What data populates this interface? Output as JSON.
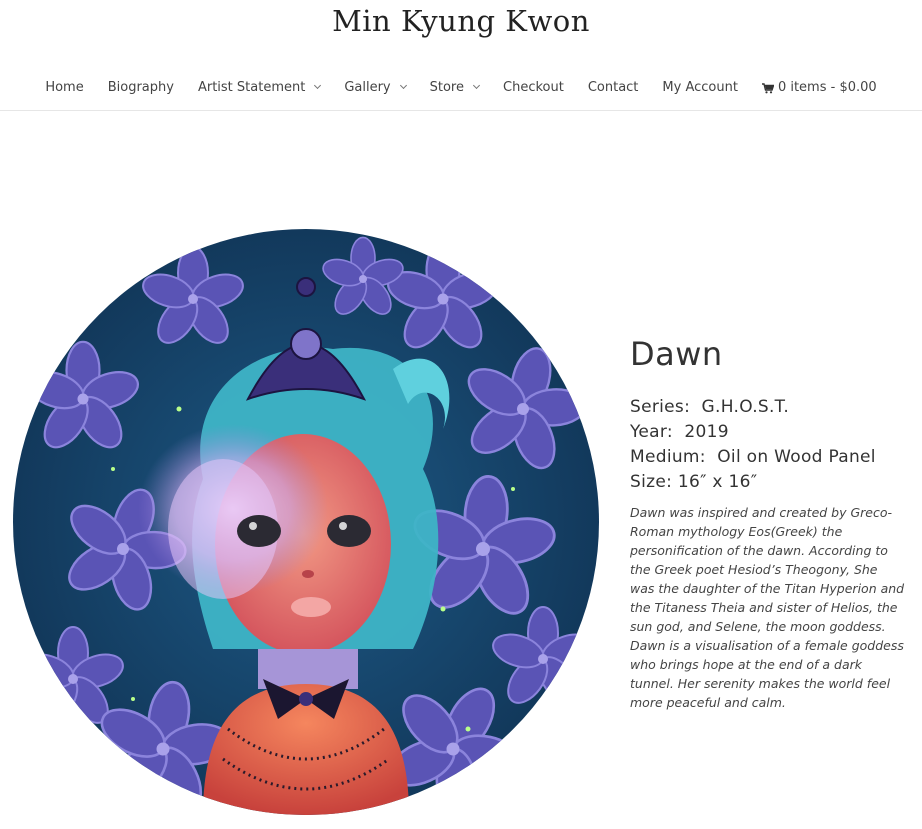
{
  "site": {
    "title": "Min Kyung Kwon"
  },
  "nav": {
    "items": [
      {
        "label": "Home",
        "dropdown": false
      },
      {
        "label": "Biography",
        "dropdown": false
      },
      {
        "label": "Artist Statement",
        "dropdown": true
      },
      {
        "label": "Gallery",
        "dropdown": true
      },
      {
        "label": "Store",
        "dropdown": true
      },
      {
        "label": "Checkout",
        "dropdown": false
      },
      {
        "label": "Contact",
        "dropdown": false
      },
      {
        "label": "My Account",
        "dropdown": false
      }
    ],
    "cart": {
      "icon": "cart-icon",
      "label": "0 items - $0.00"
    }
  },
  "artwork": {
    "title": "Dawn",
    "series_label": "Series:",
    "series": "G.H.O.S.T.",
    "year_label": "Year:",
    "year": "2019",
    "medium_label": "Medium:",
    "medium": "Oil on Wood Panel",
    "size_label": "Size:",
    "size": "16″ x 16″",
    "description": "Dawn was inspired and created by Greco-Roman mythology Eos(Greek) the personification of the dawn. According to the Greek poet Hesiod’s Theogony, She was the daughter of the Titan Hyperion and the Titaness Theia and sister of Helios, the sun god, and Selene, the moon goddess. Dawn is a visualisation of a female goddess who brings hope at the end of a dark tunnel. Her serenity makes the world feel more peaceful and calm."
  },
  "colors": {
    "painting_bg": "#173f66",
    "flower": "#5b56b8",
    "hair": "#3fb7c9",
    "skin": "#e0656a"
  }
}
